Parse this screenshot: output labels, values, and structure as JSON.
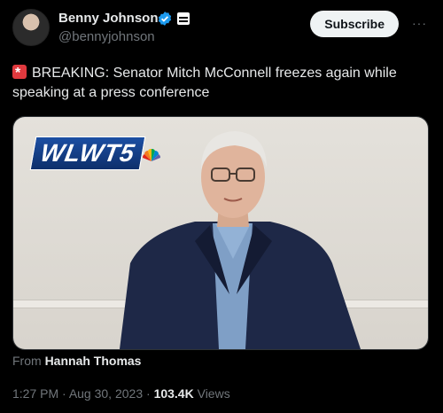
{
  "author": {
    "name": "Benny Johnson",
    "handle": "@bennyjohnson"
  },
  "header": {
    "subscribe_label": "Subscribe",
    "more_label": "···"
  },
  "tweet": {
    "text": "BREAKING: Senator Mitch McConnell freezes again while speaking at a press conference"
  },
  "media": {
    "logo_text": "WLWT5"
  },
  "attribution": {
    "prefix": "From",
    "source": "Hannah Thomas"
  },
  "meta": {
    "time": "1:27 PM",
    "date": "Aug 30, 2023",
    "views_count": "103.4K",
    "views_label": "Views"
  },
  "colors": {
    "background": "#000000",
    "verified": "#1d9bf0",
    "muted": "#71767b",
    "siren": "#e0393e"
  }
}
